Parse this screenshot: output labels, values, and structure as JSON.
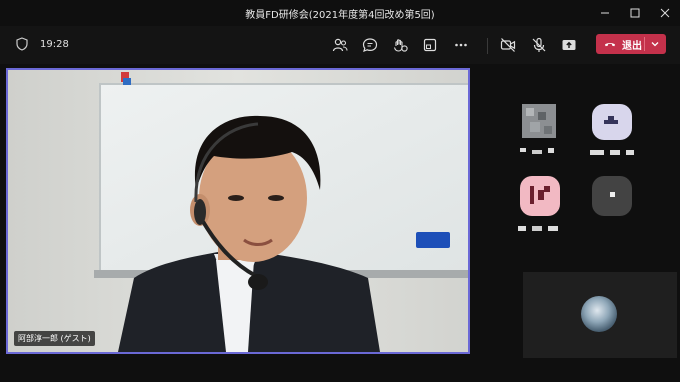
{
  "window": {
    "title": "教員FD研修会(2021年度第4回改め第5回)"
  },
  "toolbar": {
    "time": "19:28",
    "leave_label": "退出"
  },
  "video": {
    "participant_name": "阿部淳一郎 (ゲスト)"
  },
  "colors": {
    "accent_border": "#6b69d6",
    "leave_button": "#c4314b",
    "background": "#0f0f0f"
  },
  "icons": [
    "shield-icon",
    "participants-icon",
    "chat-icon",
    "reactions-icon",
    "share-tray-icon",
    "more-icon",
    "camera-off-icon",
    "mic-off-icon",
    "share-screen-icon",
    "phone-hangup-icon",
    "chevron-down-icon",
    "minimize-icon",
    "maximize-icon",
    "close-icon"
  ]
}
